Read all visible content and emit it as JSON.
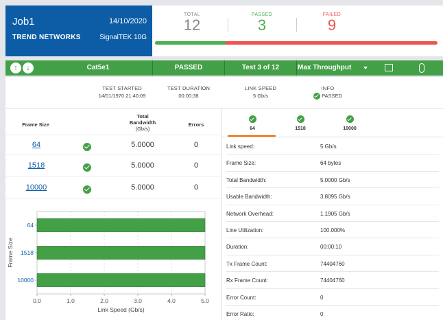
{
  "job": {
    "name": "Job1",
    "date": "14/10/2020",
    "company": "TREND NETWORKS",
    "device": "SignalTEK 10G"
  },
  "summary": {
    "total_label": "TOTAL",
    "total": "12",
    "passed_label": "PASSED",
    "passed": "3",
    "failed_label": "FAILED",
    "failed": "9",
    "passed_fraction": 0.25
  },
  "toolbar": {
    "up_arrow": "↑",
    "down_arrow": "↓",
    "cable_type": "Cat5e1",
    "status": "PASSED",
    "test_counter": "Test 3 of 12",
    "test_select": "Max Throughput"
  },
  "info": {
    "test_started_label": "TEST STARTED",
    "test_started": "14/01/1970 21:40:09",
    "test_duration_label": "TEST DURATION",
    "test_duration": "00:00:38",
    "link_speed_label": "LINK SPEED",
    "link_speed": "5 Gb/s",
    "info_label": "INFO",
    "info_value": "PASSED"
  },
  "results_table": {
    "headers": {
      "frame_size": "Frame Size",
      "total_bw_1": "Total",
      "total_bw_2": "Bandwidth",
      "total_bw_3": "(Gb/s)",
      "errors": "Errors"
    },
    "rows": [
      {
        "frame_size": "64",
        "bandwidth": "5.0000",
        "errors": "0"
      },
      {
        "frame_size": "1518",
        "bandwidth": "5.0000",
        "errors": "0"
      },
      {
        "frame_size": "10000",
        "bandwidth": "5.0000",
        "errors": "0"
      }
    ]
  },
  "chart_data": {
    "type": "bar",
    "orientation": "horizontal",
    "categories": [
      "64",
      "1518",
      "10000"
    ],
    "values": [
      5.0,
      5.0,
      5.0
    ],
    "xlabel": "Link Speed (Gb/s)",
    "ylabel": "Frame Size",
    "xlim": [
      0,
      5
    ],
    "xticks": [
      "0.0",
      "1.0",
      "2.0",
      "3.0",
      "4.0",
      "5.0"
    ],
    "grid": true,
    "bar_color": "#43a047"
  },
  "frame_tabs": [
    "64",
    "1518",
    "10000"
  ],
  "details": [
    {
      "label": "Link speed:",
      "value": "5 Gb/s"
    },
    {
      "label": "Frame Size:",
      "value": "64 bytes"
    },
    {
      "label": "Total Bandwidth:",
      "value": "5.0000 Gb/s"
    },
    {
      "label": "Usable Bandwidth:",
      "value": "3.8095 Gb/s"
    },
    {
      "label": "Network Overhead:",
      "value": "1.1905 Gb/s"
    },
    {
      "label": "Line Utilization:",
      "value": "100.000%"
    },
    {
      "label": "Duration:",
      "value": "00:00:10"
    },
    {
      "label": "Tx Frame Count:",
      "value": "74404760"
    },
    {
      "label": "Rx Frame Count:",
      "value": "74404760"
    },
    {
      "label": "Error Count:",
      "value": "0"
    },
    {
      "label": "Error Ratio:",
      "value": "0"
    }
  ]
}
